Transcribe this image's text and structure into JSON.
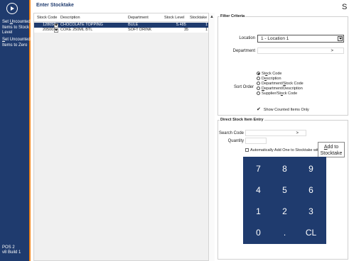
{
  "sidebar": {
    "back_icon": "circle-arrow-right-icon",
    "action1_line1_pre": "Set ",
    "action1_line1_ul": "U",
    "action1_line1_post": "ncounted",
    "action1_line2": "Items to Stock",
    "action1_line3": "Level",
    "action2_line1_ul": "S",
    "action2_line1_post": "et Uncounted",
    "action2_line2": "Items to Zero",
    "footer_line1": "POS 2",
    "footer_line2": "v8 Build 1",
    "color": "#1f3b6e",
    "accent": "#f0861e"
  },
  "header": {
    "title": "Enter Stocktake",
    "s_label": "S",
    "close_label": "✕"
  },
  "grid": {
    "columns": [
      "Stock Code",
      "Description",
      "Department",
      "Stock Level",
      "Stocktake"
    ],
    "rows": [
      {
        "code": "128058",
        "description": "CHOCOLATE TOPPING",
        "department": "BULE",
        "stock_level": "5.485",
        "stocktake": "1",
        "selected": true
      },
      {
        "code": "205001",
        "description": "COKE 250ML BTL",
        "department": "SOFT DRINK",
        "stock_level": "35",
        "stocktake": "1",
        "selected": false
      }
    ]
  },
  "filter": {
    "title": "Filter Criteria",
    "location_label": "Location",
    "location_value": "1 - Location 1",
    "department_label": "Department",
    "department_value": ">",
    "sort_label": "Sort Order",
    "sort_options": [
      {
        "pre": "St",
        "ul": "o",
        "post": "ck Code",
        "selected": true
      },
      {
        "pre": "D",
        "ul": "e",
        "post": "scription",
        "selected": false
      },
      {
        "pre": "Department/",
        "ul": "S",
        "post": "tock Code",
        "selected": false
      },
      {
        "pre": "",
        "ul": "D",
        "post": "epartment/Description",
        "selected": false
      },
      {
        "pre": "Supplier/St",
        "ul": "o",
        "post": "ck Code",
        "selected": false
      }
    ],
    "show_counted_label": "Show Counted Items Only"
  },
  "direct": {
    "title": "Direct Stock Item Entry",
    "search_label": "Search Code",
    "search_value": ">",
    "quantity_label": "Quantity",
    "quantity_value": "",
    "add_line1_ul": "A",
    "add_line1_post": "dd to",
    "add_line2": "Stocktake",
    "auto_add_label": "Automatically Add One to Stocktake with each Scan"
  },
  "keypad": {
    "keys": [
      "7",
      "8",
      "9",
      "4",
      "5",
      "6",
      "1",
      "2",
      "3",
      "0",
      ".",
      "CL"
    ],
    "color": "#1f3b6e"
  }
}
